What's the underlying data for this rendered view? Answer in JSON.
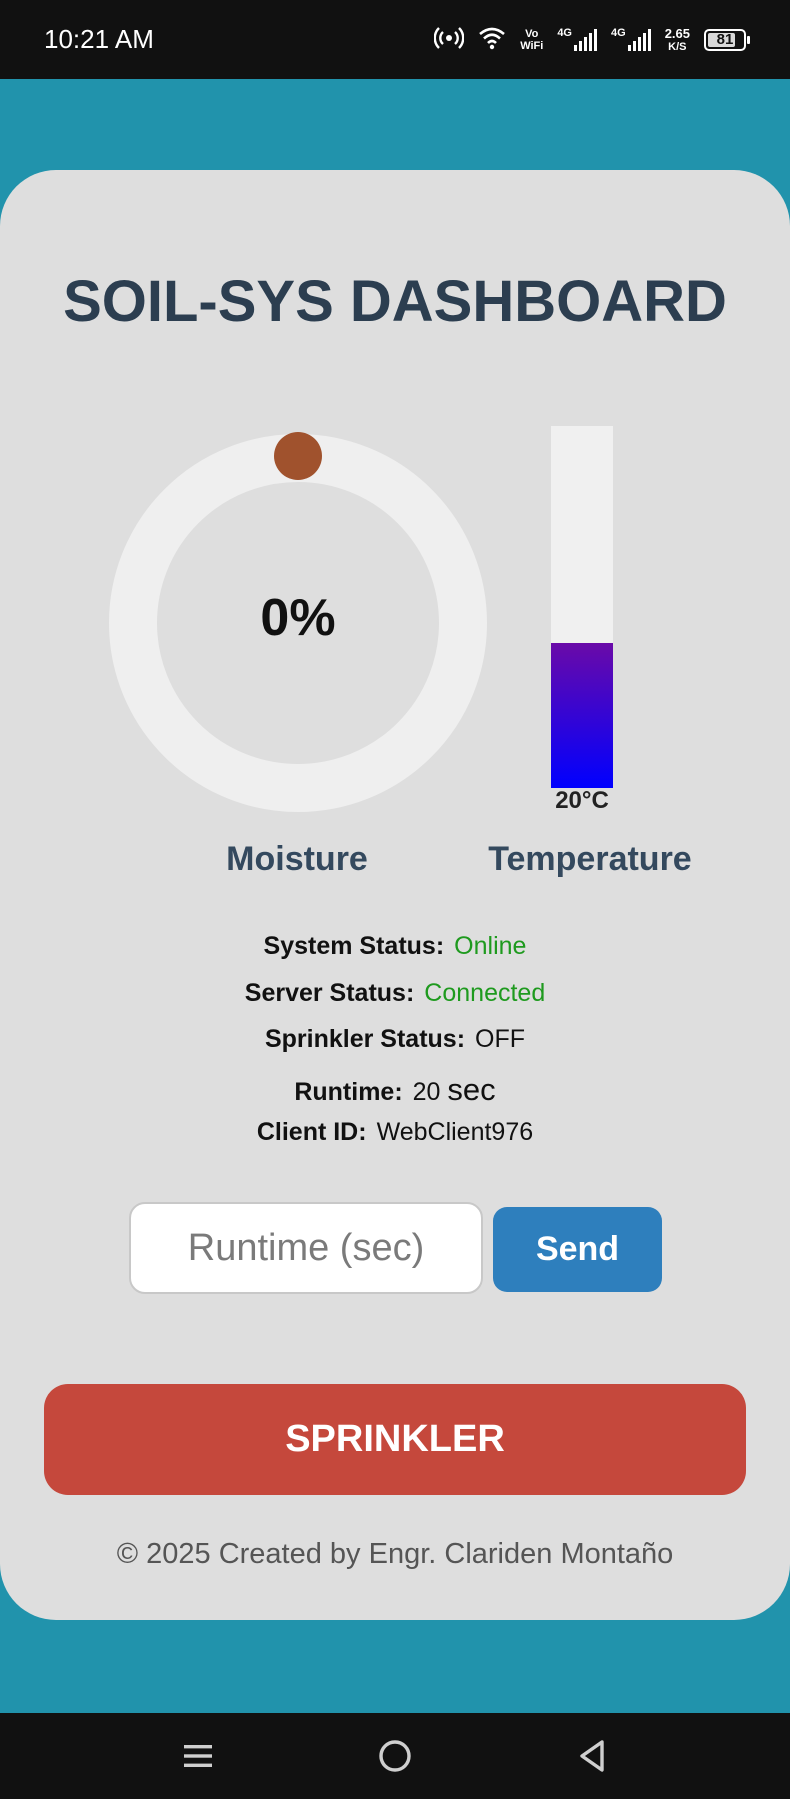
{
  "status_bar": {
    "time": "10:21 AM",
    "volte_label": "Vo\nWiFi",
    "net1": "4G",
    "net2": "4G",
    "speed_value": "2.65",
    "speed_unit": "K/S",
    "battery": "81",
    "battery_percent": 81
  },
  "dashboard": {
    "title": "SOIL-SYS DASHBOARD",
    "moisture": {
      "value_text": "0%",
      "value": 0,
      "label": "Moisture",
      "ring_color": "#efefef",
      "indicator_color": "#a0522d"
    },
    "temperature": {
      "value_text": "20°C",
      "value": 20,
      "fill_fraction": 0.4,
      "label": "Temperature"
    }
  },
  "status": {
    "system_label": "System Status:",
    "system_value": "Online",
    "server_label": "Server Status:",
    "server_value": "Connected",
    "sprinkler_label": "Sprinkler Status:",
    "sprinkler_value": "OFF",
    "runtime_label": "Runtime:",
    "runtime_value": "20",
    "runtime_unit": "sec",
    "client_label": "Client ID:",
    "client_value": "WebClient976"
  },
  "controls": {
    "runtime_placeholder": "Runtime (sec)",
    "send_label": "Send",
    "sprinkler_label": "SPRINKLER"
  },
  "footer": {
    "text": "© 2025 Created by Engr. Clariden Montaño"
  },
  "colors": {
    "background": "#2193ac",
    "card": "#dedede",
    "title": "#2c3e50",
    "online": "#1e9a1e",
    "send": "#2e7fbd",
    "sprinkler": "#c5483c"
  },
  "nav": {
    "icons": [
      "menu-icon",
      "home-icon",
      "back-icon"
    ]
  }
}
